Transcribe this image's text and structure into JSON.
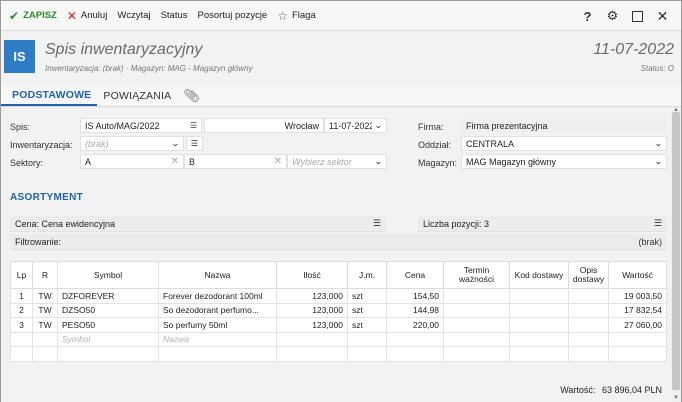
{
  "toolbar": {
    "save": "ZAPISZ",
    "cancel": "Anuluj",
    "load": "Wczytaj",
    "status": "Status",
    "sort": "Posortuj pozycje",
    "flag": "Flaga"
  },
  "header": {
    "icon_text": "IS",
    "title": "Spis inwentaryzacyjny",
    "subtitle": "Inwentaryzacja: (brak)  ·  Magazyn: MAG - Magazyn główny",
    "date": "11-07-2022",
    "status": "Status: O"
  },
  "tabs": [
    "PODSTAWOWE",
    "POWIĄZANIA"
  ],
  "form": {
    "spis_label": "Spis:",
    "spis_value": "IS Auto/MAG/2022",
    "place_value": "Wrocław",
    "date_value": "11-07-2022",
    "inw_label": "Inwentaryzacja:",
    "inw_placeholder": "(brak)",
    "sektory_label": "Sektory:",
    "sektor_a": "A",
    "sektor_b": "B",
    "sektor_placeholder": "Wybierz sektor",
    "firma_label": "Firma:",
    "firma_value": "Firma prezentacyjna",
    "oddzial_label": "Oddział:",
    "oddzial_value": "CENTRALA",
    "magazyn_label": "Magazyn:",
    "magazyn_value": "MAG  Magazyn główny"
  },
  "assortment": {
    "title": "ASORTYMENT",
    "cena": "Cena: Cena ewidencyjna",
    "liczba": "Liczba pozycji: 3",
    "filter_label": "Filtrowanie:",
    "filter_value": "(brak)",
    "columns": [
      "Lp",
      "R",
      "Symbol",
      "Nazwa",
      "Ilość",
      "J.m.",
      "Cena",
      "Termin ważności",
      "Kod dostawy",
      "Opis dostawy",
      "Wartość"
    ],
    "rows": [
      {
        "lp": "1",
        "r": "TW",
        "symbol": "DZFOREVER",
        "nazwa": "Forever dezodorant 100ml",
        "ilosc": "123,000",
        "jm": "szt",
        "cena": "154,50",
        "termin": "",
        "kod": "",
        "opis": "",
        "wartosc": "19 003,50"
      },
      {
        "lp": "2",
        "r": "TW",
        "symbol": "DZSO50",
        "nazwa": "So dezodorant perfumo...",
        "ilosc": "123,000",
        "jm": "szt",
        "cena": "144,98",
        "termin": "",
        "kod": "",
        "opis": "",
        "wartosc": "17 832,54"
      },
      {
        "lp": "3",
        "r": "TW",
        "symbol": "PESO50",
        "nazwa": "So perfumy 50ml",
        "ilosc": "123,000",
        "jm": "szt",
        "cena": "220,00",
        "termin": "",
        "kod": "",
        "opis": "",
        "wartosc": "27 060,00"
      }
    ],
    "new_symbol_placeholder": "Symbol",
    "new_nazwa_placeholder": "Nazwa",
    "total_label": "Wartość:",
    "total_value": "63 896,04 PLN"
  }
}
